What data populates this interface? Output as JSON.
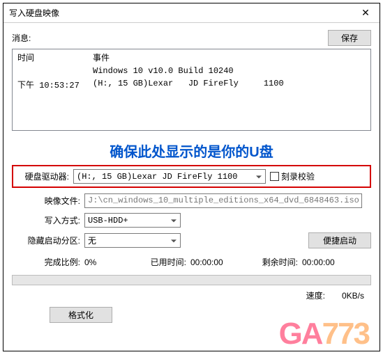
{
  "window": {
    "title": "写入硬盘映像"
  },
  "toolbar": {
    "info_label": "消息:",
    "save_label": "保存"
  },
  "log": {
    "col_time": "时间",
    "col_event": "事件",
    "rows": [
      {
        "time": "",
        "event": "Windows 10 v10.0 Build 10240"
      },
      {
        "time": "下午 10:53:27",
        "event": "(H:, 15 GB)Lexar   JD FireFly     1100"
      }
    ]
  },
  "annotation": "确保此处显示的是你的U盘",
  "fields": {
    "drive_label": "硬盘驱动器:",
    "drive_value": "(H:, 15 GB)Lexar   JD FireFly     1100",
    "verify_label": "刻录校验",
    "image_label": "映像文件:",
    "image_value": "J:\\cn_windows_10_multiple_editions_x64_dvd_6848463.iso",
    "write_method_label": "写入方式:",
    "write_method_value": "USB-HDD+",
    "hidden_label": "隐藏启动分区:",
    "hidden_value": "无",
    "convenient_boot_label": "便捷启动"
  },
  "progress": {
    "percent_label": "完成比例:",
    "percent_value": "0%",
    "elapsed_label": "已用时间:",
    "elapsed_value": "00:00:00",
    "remaining_label": "剩余时间:",
    "remaining_value": "00:00:00",
    "speed_label": "速度:",
    "speed_value": "0KB/s"
  },
  "actions": {
    "format_label": "格式化"
  },
  "watermark": {
    "a": "GA",
    "b": "773"
  }
}
